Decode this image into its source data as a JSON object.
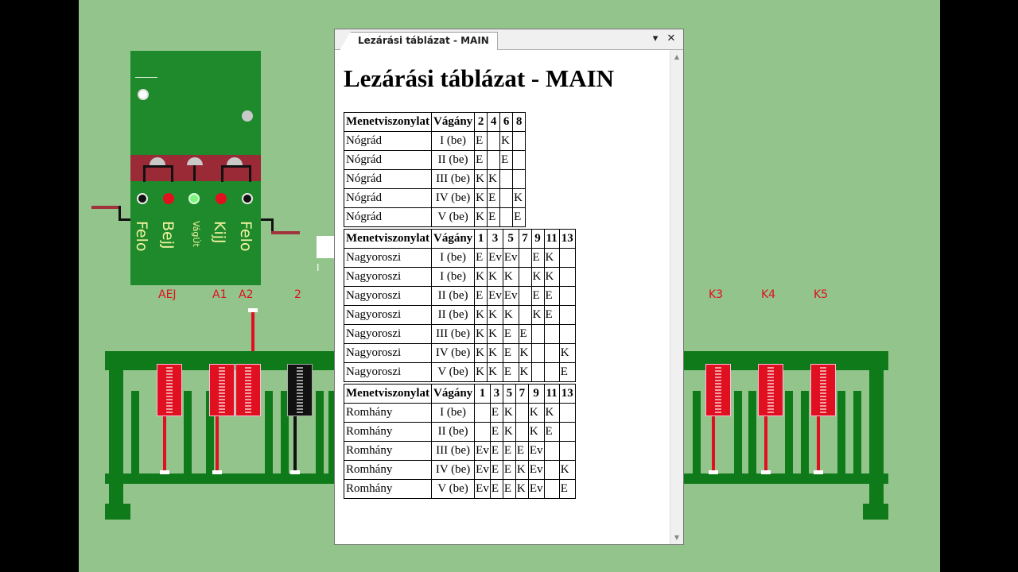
{
  "panel": {
    "labels": [
      "Felo",
      "BejJ",
      "VágÚt",
      "KijJ",
      "Felo"
    ]
  },
  "track_labels": [
    "AEJ",
    "A1",
    "A2",
    "2",
    "K3",
    "K4",
    "K5"
  ],
  "misc": {
    "small_label": "I"
  },
  "window": {
    "tab_title": "Lezárási táblázat - MAIN",
    "menu_glyph": "▾",
    "close_glyph": "✕",
    "heading": "Lezárási táblázat - MAIN"
  },
  "tables": [
    {
      "headers": [
        "Menetviszonylat",
        "Vágány",
        "2",
        "4",
        "6",
        "8"
      ],
      "rows": [
        [
          "Nógrád",
          "I (be)",
          "E",
          "",
          "K",
          ""
        ],
        [
          "Nógrád",
          "II (be)",
          "E",
          "",
          "E",
          ""
        ],
        [
          "Nógrád",
          "III (be)",
          "K",
          "K",
          "",
          ""
        ],
        [
          "Nógrád",
          "IV (be)",
          "K",
          "E",
          "",
          "K"
        ],
        [
          "Nógrád",
          "V (be)",
          "K",
          "E",
          "",
          "E"
        ]
      ]
    },
    {
      "headers": [
        "Menetviszonylat",
        "Vágány",
        "1",
        "3",
        "5",
        "7",
        "9",
        "11",
        "13"
      ],
      "rows": [
        [
          "Nagyoroszi",
          "I (be)",
          "E",
          "Ev",
          "Ev",
          "",
          "E",
          "K",
          ""
        ],
        [
          "Nagyoroszi",
          "I (be)",
          "K",
          "K",
          "K",
          "",
          "K",
          "K",
          ""
        ],
        [
          "Nagyoroszi",
          "II (be)",
          "E",
          "Ev",
          "Ev",
          "",
          "E",
          "E",
          ""
        ],
        [
          "Nagyoroszi",
          "II (be)",
          "K",
          "K",
          "K",
          "",
          "K",
          "E",
          ""
        ],
        [
          "Nagyoroszi",
          "III (be)",
          "K",
          "K",
          "E",
          "E",
          "",
          "",
          ""
        ],
        [
          "Nagyoroszi",
          "IV (be)",
          "K",
          "K",
          "E",
          "K",
          "",
          "",
          "K"
        ],
        [
          "Nagyoroszi",
          "V (be)",
          "K",
          "K",
          "E",
          "K",
          "",
          "",
          "E"
        ]
      ]
    },
    {
      "headers": [
        "Menetviszonylat",
        "Vágány",
        "1",
        "3",
        "5",
        "7",
        "9",
        "11",
        "13"
      ],
      "rows": [
        [
          "Romhány",
          "I (be)",
          "",
          "E",
          "K",
          "",
          "K",
          "K",
          ""
        ],
        [
          "Romhány",
          "II (be)",
          "",
          "E",
          "K",
          "",
          "K",
          "E",
          ""
        ],
        [
          "Romhány",
          "III (be)",
          "Ev",
          "E",
          "E",
          "E",
          "Ev",
          "",
          ""
        ],
        [
          "Romhány",
          "IV (be)",
          "Ev",
          "E",
          "E",
          "K",
          "Ev",
          "",
          "K"
        ],
        [
          "Romhány",
          "V (be)",
          "Ev",
          "E",
          "E",
          "K",
          "Ev",
          "",
          "E"
        ]
      ]
    }
  ]
}
